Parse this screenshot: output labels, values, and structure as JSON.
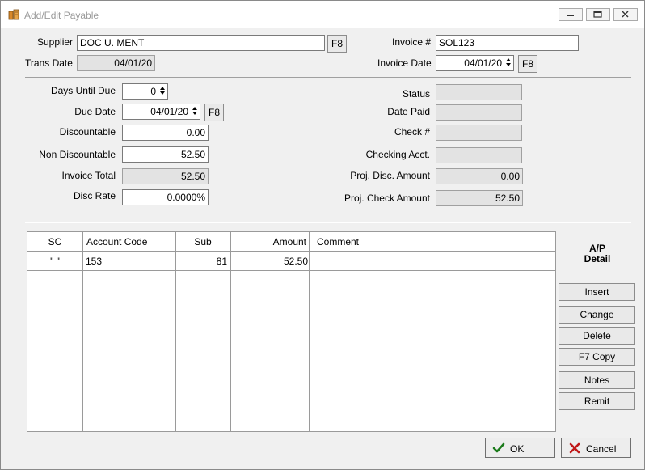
{
  "window": {
    "title": "Add/Edit Payable",
    "controls": [
      "minimize-icon",
      "restore-icon",
      "close-icon"
    ]
  },
  "header": {
    "supplier_label": "Supplier",
    "supplier_value": "DOC U. MENT",
    "supplier_f8": "F8",
    "trans_date_label": "Trans Date",
    "trans_date_value": "04/01/20",
    "invoice_label": "Invoice #",
    "invoice_value": "SOL123",
    "invoice_date_label": "Invoice Date",
    "invoice_date_value": "04/01/20",
    "invoice_date_f8": "F8"
  },
  "terms": {
    "days_until_due_label": "Days Until Due",
    "days_until_due_value": "0",
    "due_date_label": "Due Date",
    "due_date_value": "04/01/20",
    "due_date_f8": "F8",
    "discountable_label": "Discountable",
    "discountable_value": "0.00",
    "non_discountable_label": "Non Discountable",
    "non_discountable_value": "52.50",
    "invoice_total_label": "Invoice Total",
    "invoice_total_value": "52.50",
    "disc_rate_label": "Disc Rate",
    "disc_rate_value": "0.0000%"
  },
  "payment": {
    "status_label": "Status",
    "status_value": "",
    "date_paid_label": "Date Paid",
    "date_paid_value": "",
    "check_label": "Check #",
    "check_value": "",
    "checking_acct_label": "Checking Acct.",
    "checking_acct_value": "",
    "proj_disc_label": "Proj. Disc. Amount",
    "proj_disc_value": "0.00",
    "proj_check_label": "Proj. Check Amount",
    "proj_check_value": "52.50"
  },
  "detail_grid": {
    "columns": [
      "SC",
      "Account Code",
      "Sub",
      "Amount",
      "Comment"
    ],
    "rows": [
      {
        "sc": "\" \"",
        "account_code": "153",
        "sub": "81",
        "amount": "52.50",
        "comment": ""
      }
    ]
  },
  "side_panel": {
    "title_line1": "A/P",
    "title_line2": "Detail",
    "insert": "Insert",
    "change": "Change",
    "delete": "Delete",
    "copy": "F7 Copy",
    "notes": "Notes",
    "remit": "Remit"
  },
  "footer": {
    "ok": "OK",
    "cancel": "Cancel"
  },
  "colors": {
    "ok_check": "#1a7a1a",
    "cancel_x": "#c01818",
    "app_icon": "#d9892b"
  }
}
